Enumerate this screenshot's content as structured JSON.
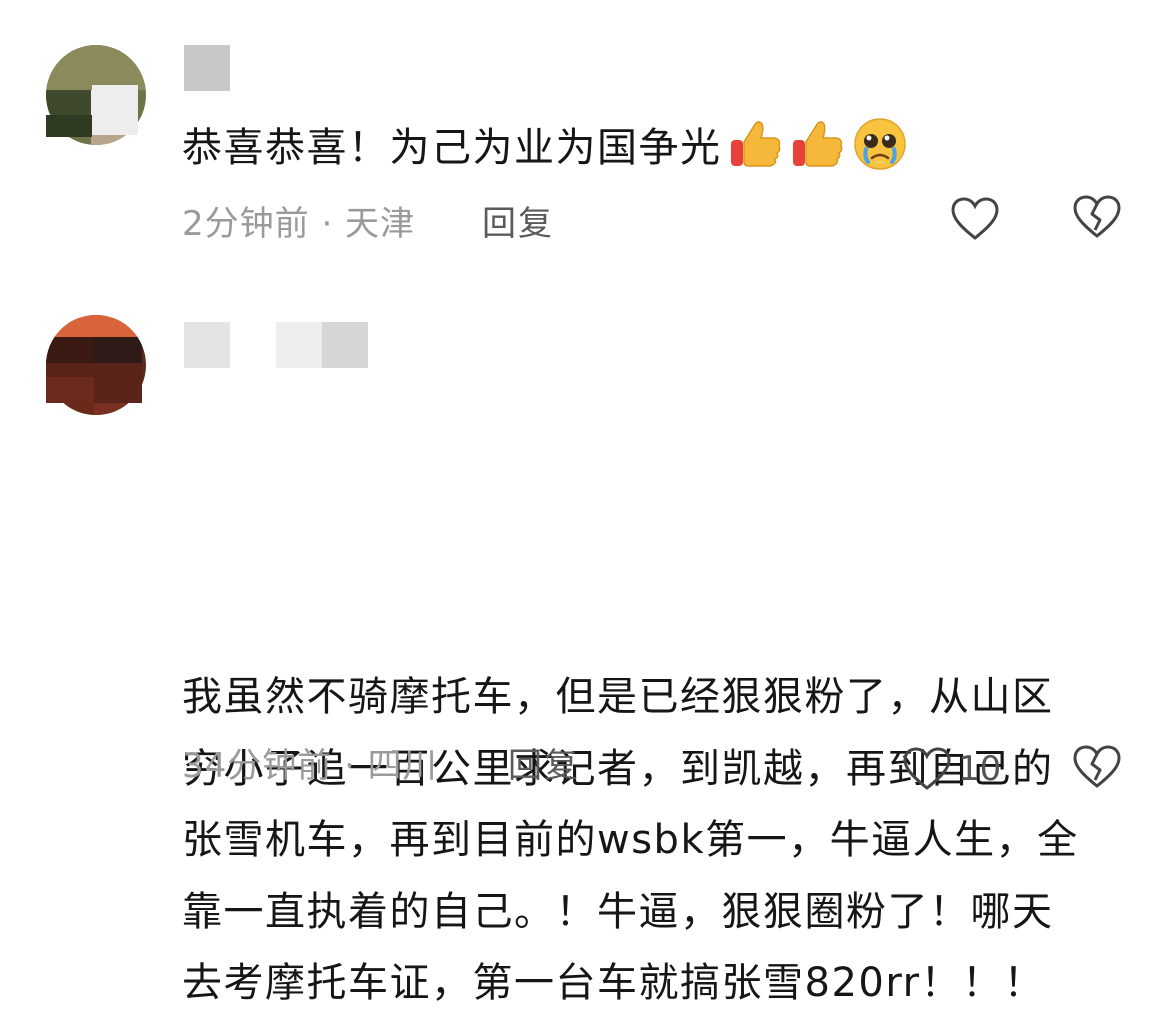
{
  "comments": [
    {
      "text": "恭喜恭喜！为己为业为国争光",
      "emojis": [
        "thumbs-up-icon",
        "thumbs-up-icon",
        "pleading-face-icon"
      ],
      "time": "2分钟前",
      "location": "天津",
      "meta": "2分钟前 · 天津",
      "reply_label": "回复",
      "like_count": ""
    },
    {
      "text": "我虽然不骑摩托车，但是已经狠狠粉了，从山区\n穷小子追一百公里求记者，到凯越，再到自己的\n张雪机车，再到目前的wsbk第一，牛逼人生，全\n靠一直执着的自己。！牛逼，狠狠圈粉了！哪天\n去考摩托车证，第一台车就搞张雪820rr！！！",
      "time": "34分钟前",
      "location": "四川",
      "meta": "34分钟前 · 四川",
      "reply_label": "回复",
      "like_count": "10"
    }
  ],
  "colors": {
    "text": "#161616",
    "meta": "#9a9a9a",
    "reply": "#5a5a5a",
    "icon": "#444444",
    "thumb_yellow": "#F6B83A",
    "thumb_red": "#E8413A"
  }
}
